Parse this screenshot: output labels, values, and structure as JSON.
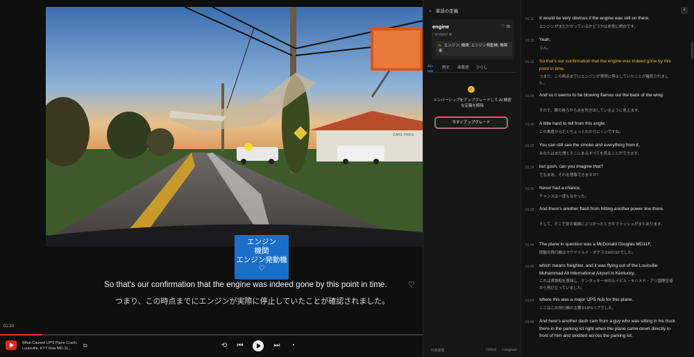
{
  "player": {
    "timecode": "01:20",
    "progress": 0.1,
    "title": "What Caused UPS Plane Crash, Louisville, KY? How MD-11...",
    "popup": {
      "lines": [
        "エンジン",
        "機関",
        "エンジン発動機"
      ],
      "heart": "♡"
    },
    "subtitle_en": "So that's our confirmation that the engine was indeed gone by this point in time.",
    "subtitle_ja": "つまり、この時点までにエンジンが実際に停止していたことが確認されました。",
    "subtitle_heart": "♡",
    "billboard_text": "CARS TIRES",
    "controls": {
      "loop": "⟲",
      "prev": "⏮",
      "next": "⏭",
      "speed": "◔",
      "external": "⧉"
    }
  },
  "dictionary": {
    "header": "単語の定義",
    "close": "×",
    "word": "engine",
    "pronunciation": "/ˈendʒɪn/ ⊕",
    "icons": "♡ ⊞",
    "pos": "n.",
    "definition": "エンジン; 機関; エンジン発動機; 機関車",
    "tabs": [
      "AI+",
      "例文",
      "画像語",
      "ひらし"
    ],
    "upgrade_icon": "✓",
    "upgrade_text": "メンバーシップをアップグレードして AI 精密な定義を解除",
    "upgrade_button": "今すぐアップグレード",
    "footer_left": "⋮ 内容辞書",
    "footer_oxford": "Oxford",
    "footer_longman": "Longman",
    "colors": {
      "accent": "#4da3ff",
      "gold": "#f0b429"
    }
  },
  "transcript": {
    "close": "×",
    "items": [
      {
        "time": "01:11",
        "en": "It would be very obvious if the engine was still on there.",
        "ja": "エンジンがまだかかっているかどうかは非常に明白です。",
        "active": false
      },
      {
        "time": "01:15",
        "en": "Yeah.",
        "ja": "うん。",
        "active": false
      },
      {
        "time": "01:16",
        "en": "So that's our confirmation that the engine was indeed gone by this point in time.",
        "ja": "つまり、この時点までにエンジンが実際に停止していたことが確認されました。",
        "active": true
      },
      {
        "time": "01:24",
        "en": "And so it seems to be blowing flames out the back of the wing.",
        "ja": "それで、翼の後ろから炎を吹き出しているように見えます。",
        "active": false
      },
      {
        "time": "01:30",
        "en": "A little hard to tell from this angle.",
        "ja": "この角度からだとちょっとわかりにくいですね。",
        "active": false
      },
      {
        "time": "01:33",
        "en": "You can still see the smoke and everything from it,",
        "ja": "あなたはまだ煙とそこにあるすべてを見ることができます、",
        "active": false
      },
      {
        "time": "01:34",
        "en": "but gosh, can you imagine that?",
        "ja": "でもまあ、それを想像できますか?",
        "active": false
      },
      {
        "time": "01:36",
        "en": "Never had a chance.",
        "ja": "チャンスは一度もなかった。",
        "active": false
      },
      {
        "time": "01:38",
        "en": "And there's another flash from hitting another power line there.",
        "ja": "そして、そこで別の電線にぶつかったときのフラッシュがまたあります。",
        "active": false
      },
      {
        "time": "01:44",
        "en": "The plane in question was a McDonald Douglas MD11F,",
        "ja": "問題の飛行機はマクドナルド・ダグラスMD11Fでした。",
        "active": false
      },
      {
        "time": "01:48",
        "en": "which means freighter, and it was flying out of the Louisville Muhammad Ali International Airport in Kentucky,",
        "ja": "これは貨物船を意味し、ケンタッキー州のルイビル・モハメド・アリ国際空港から飛び立っていました。",
        "active": false
      },
      {
        "time": "01:54",
        "en": "where this was a major UPS hub for this plane.",
        "ja": "ここはこの飛行機の主要なUPSハブでした。",
        "active": false
      },
      {
        "time": "01:58",
        "en": "And here's another dash cam from a guy who was sitting in his truck there in the parking lot right when the plane came down directly in front of him and skidded across the parking lot.",
        "ja": "",
        "active": false
      }
    ]
  }
}
